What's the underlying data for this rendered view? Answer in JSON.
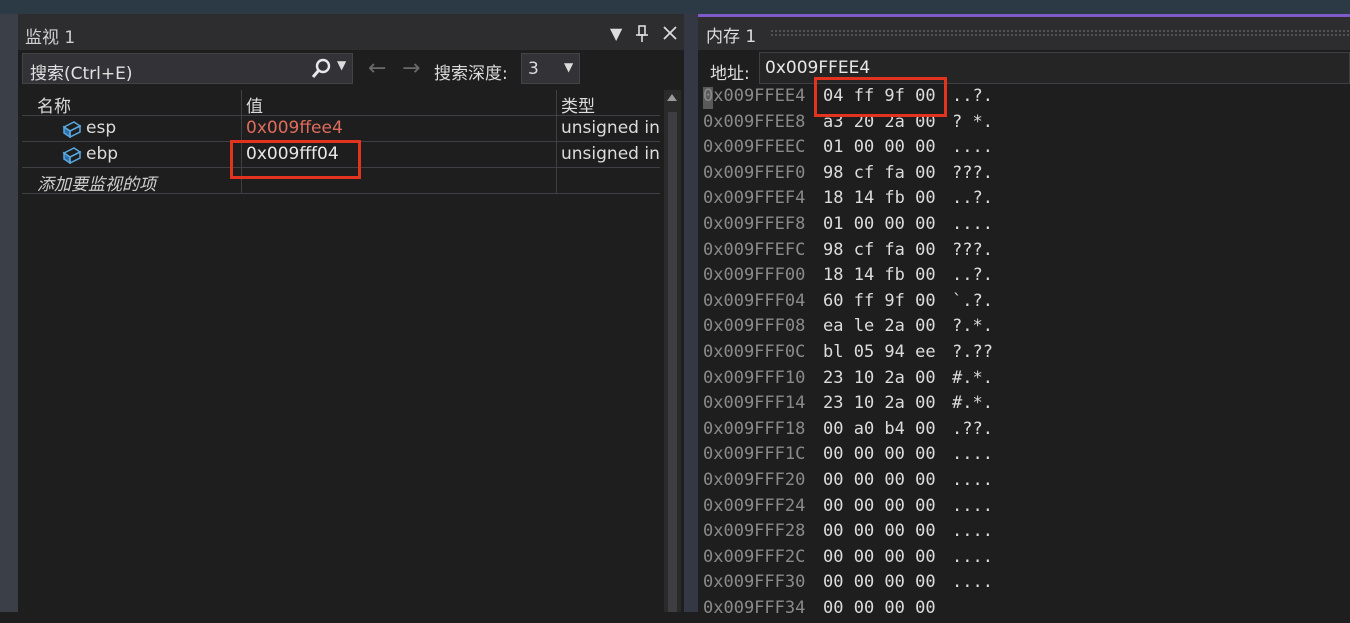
{
  "watch": {
    "title": "监视 1",
    "search_placeholder": "搜索(Ctrl+E)",
    "depth_label": "搜索深度:",
    "depth_value": "3",
    "columns": [
      "名称",
      "值",
      "类型"
    ],
    "rows": [
      {
        "name": "esp",
        "value": "0x009ffee4",
        "type": "unsigned int",
        "value_color": "#e06c5c"
      },
      {
        "name": "ebp",
        "value": "0x009fff04",
        "type": "unsigned int",
        "value_color": "#e8e8e8"
      }
    ],
    "add_item": "添加要监视的项"
  },
  "memory": {
    "title": "内存 1",
    "address_label": "地址:",
    "address_value": "0x009FFEE4",
    "rows": [
      {
        "addr": "0x009FFEE4",
        "bytes": "04 ff 9f 00",
        "ascii": "..?."
      },
      {
        "addr": "0x009FFEE8",
        "bytes": "a3 20 2a 00",
        "ascii": "? *."
      },
      {
        "addr": "0x009FFEEC",
        "bytes": "01 00 00 00",
        "ascii": "...."
      },
      {
        "addr": "0x009FFEF0",
        "bytes": "98 cf fa 00",
        "ascii": "???."
      },
      {
        "addr": "0x009FFEF4",
        "bytes": "18 14 fb 00",
        "ascii": "..?."
      },
      {
        "addr": "0x009FFEF8",
        "bytes": "01 00 00 00",
        "ascii": "...."
      },
      {
        "addr": "0x009FFEFC",
        "bytes": "98 cf fa 00",
        "ascii": "???."
      },
      {
        "addr": "0x009FFF00",
        "bytes": "18 14 fb 00",
        "ascii": "..?."
      },
      {
        "addr": "0x009FFF04",
        "bytes": "60 ff 9f 00",
        "ascii": "`.?."
      },
      {
        "addr": "0x009FFF08",
        "bytes": "ea le 2a 00",
        "ascii": "?.*."
      },
      {
        "addr": "0x009FFF0C",
        "bytes": "bl 05 94 ee",
        "ascii": "?.??"
      },
      {
        "addr": "0x009FFF10",
        "bytes": "23 10 2a 00",
        "ascii": "#.*."
      },
      {
        "addr": "0x009FFF14",
        "bytes": "23 10 2a 00",
        "ascii": "#.*."
      },
      {
        "addr": "0x009FFF18",
        "bytes": "00 a0 b4 00",
        "ascii": ".??."
      },
      {
        "addr": "0x009FFF1C",
        "bytes": "00 00 00 00",
        "ascii": "...."
      },
      {
        "addr": "0x009FFF20",
        "bytes": "00 00 00 00",
        "ascii": "...."
      },
      {
        "addr": "0x009FFF24",
        "bytes": "00 00 00 00",
        "ascii": "...."
      },
      {
        "addr": "0x009FFF28",
        "bytes": "00 00 00 00",
        "ascii": "...."
      },
      {
        "addr": "0x009FFF2C",
        "bytes": "00 00 00 00",
        "ascii": "...."
      },
      {
        "addr": "0x009FFF30",
        "bytes": "00 00 00 00",
        "ascii": "...."
      },
      {
        "addr": "0x009FFF34",
        "bytes": "00 00 00 00",
        "ascii": ""
      }
    ]
  },
  "colors": {
    "accent": "#7e5bc8",
    "highlight": "#e2331f"
  },
  "icons": {
    "watch_var": "cube-icon",
    "search": "search-icon"
  }
}
